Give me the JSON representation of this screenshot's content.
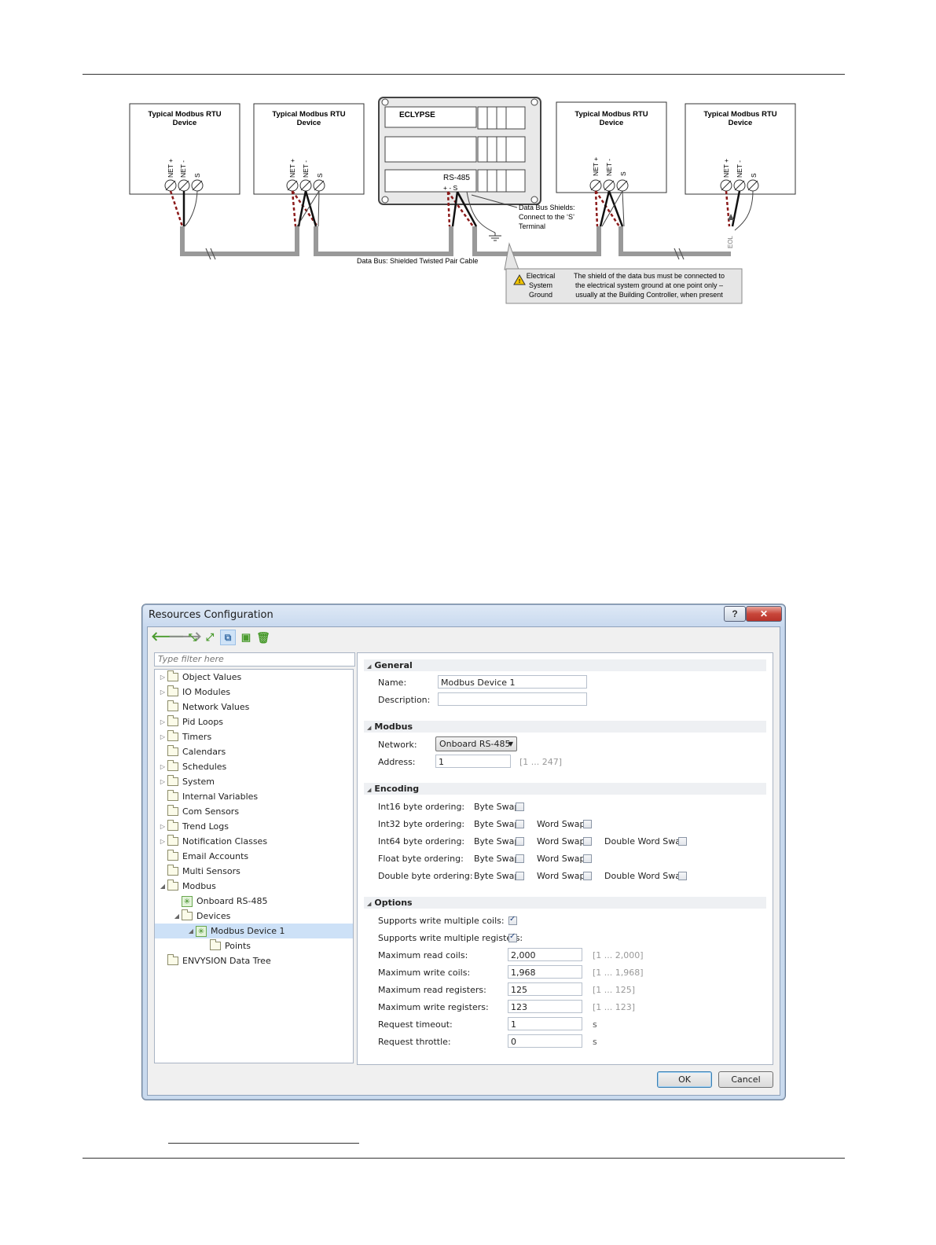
{
  "diagram": {
    "device_label_line1": "Typical Modbus RTU",
    "device_label_line2": "Device",
    "terminal_net_plus": "NET +",
    "terminal_net_minus": "NET -",
    "terminal_s": "S",
    "controller_label": "ECLYPSE",
    "rs485_label": "RS-485",
    "rs485_terminals": "+  -  S",
    "shield_note_line1": "Data Bus Shields:",
    "shield_note_line2": "Connect to the ‘S’",
    "shield_note_line3": "Terminal",
    "bus_label": "Data Bus: Shielded Twisted Pair Cable",
    "ground_line1": "Electrical",
    "ground_line2": "System",
    "ground_line3": "Ground",
    "ground_note_line1": "The shield of the data bus must be connected to",
    "ground_note_line2": "the electrical system ground at one point only –",
    "ground_note_line3": "usually at the Building Controller, when present",
    "eol_label": "EOL"
  },
  "dialog": {
    "title": "Resources Configuration",
    "help_label": "?",
    "close_label": "✕",
    "filter_placeholder": "Type filter here",
    "tree": [
      {
        "label": "Object Values",
        "arrow": "▷"
      },
      {
        "label": "IO Modules",
        "arrow": "▷"
      },
      {
        "label": "Network Values",
        "arrow": ""
      },
      {
        "label": "Pid Loops",
        "arrow": "▷"
      },
      {
        "label": "Timers",
        "arrow": "▷"
      },
      {
        "label": "Calendars",
        "arrow": ""
      },
      {
        "label": "Schedules",
        "arrow": "▷"
      },
      {
        "label": "System",
        "arrow": "▷"
      },
      {
        "label": "Internal Variables",
        "arrow": ""
      },
      {
        "label": "Com Sensors",
        "arrow": ""
      },
      {
        "label": "Trend Logs",
        "arrow": "▷"
      },
      {
        "label": "Notification Classes",
        "arrow": "▷"
      },
      {
        "label": "Email Accounts",
        "arrow": ""
      },
      {
        "label": "Multi Sensors",
        "arrow": ""
      },
      {
        "label": "Modbus",
        "arrow": "◢"
      },
      {
        "label": "Onboard RS-485",
        "arrow": ""
      },
      {
        "label": "Devices",
        "arrow": "◢"
      },
      {
        "label": "Modbus Device 1",
        "arrow": "◢"
      },
      {
        "label": "Points",
        "arrow": ""
      },
      {
        "label": "ENVYSION Data Tree",
        "arrow": ""
      }
    ],
    "general": {
      "header": "General",
      "name_label": "Name:",
      "name_value": "Modbus Device 1",
      "description_label": "Description:",
      "description_value": ""
    },
    "modbus": {
      "header": "Modbus",
      "network_label": "Network:",
      "network_value": "Onboard RS-485",
      "address_label": "Address:",
      "address_value": "1",
      "address_hint": "[1 ... 247]"
    },
    "encoding": {
      "header": "Encoding",
      "byte_swap": "Byte Swap",
      "word_swap": "Word Swap",
      "double_word_swap": "Double Word Swap",
      "rows": [
        {
          "label": "Int16 byte ordering:"
        },
        {
          "label": "Int32 byte ordering:"
        },
        {
          "label": "Int64 byte ordering:"
        },
        {
          "label": "Float byte ordering:"
        },
        {
          "label": "Double byte ordering:"
        }
      ]
    },
    "options": {
      "header": "Options",
      "write_coils_label": "Supports write multiple coils:",
      "write_registers_label": "Supports write multiple registers:",
      "max_read_coils_label": "Maximum read coils:",
      "max_read_coils_value": "2,000",
      "max_read_coils_hint": "[1 ... 2,000]",
      "max_write_coils_label": "Maximum write coils:",
      "max_write_coils_value": "1,968",
      "max_write_coils_hint": "[1 ... 1,968]",
      "max_read_registers_label": "Maximum read registers:",
      "max_read_registers_value": "125",
      "max_read_registers_hint": "[1 ... 125]",
      "max_write_registers_label": "Maximum write registers:",
      "max_write_registers_value": "123",
      "max_write_registers_hint": "[1 ... 123]",
      "request_timeout_label": "Request timeout:",
      "request_timeout_value": "1",
      "request_timeout_unit": "s",
      "request_throttle_label": "Request throttle:",
      "request_throttle_value": "0",
      "request_throttle_unit": "s"
    },
    "ok_label": "OK",
    "cancel_label": "Cancel"
  },
  "colors": {
    "accent_green": "#4a9b2e",
    "wire_red": "#8b1a1a",
    "selection": "#cde1f7"
  }
}
